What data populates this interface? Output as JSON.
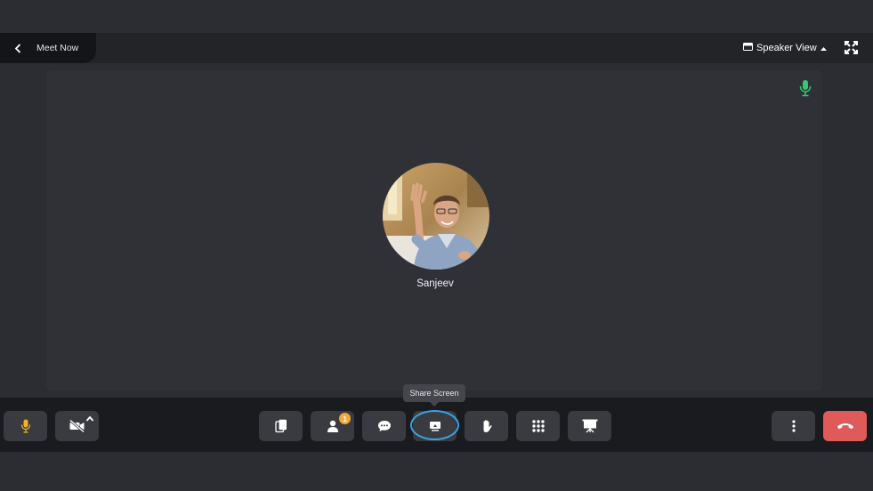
{
  "header": {
    "back_icon": "chevron-left-icon",
    "title": "Meet Now",
    "view_label": "Speaker View",
    "view_icon": "layout-icon",
    "fullscreen_icon": "fullscreen-icon"
  },
  "stage": {
    "participant_name": "Sanjeev",
    "mic_status": "active",
    "mic_color": "#2ecc71"
  },
  "toolbar": {
    "mic_icon": "microphone-icon",
    "mic_color": "#f0b429",
    "camera_icon": "video-off-icon",
    "participants_badge": "1",
    "share_tooltip": "Share Screen",
    "end_call_color": "#e05a5a",
    "buttons": [
      "microphone",
      "camera",
      "copy",
      "participants",
      "chat",
      "share-screen",
      "raise-hand",
      "apps",
      "whiteboard",
      "more",
      "end-call"
    ]
  },
  "colors": {
    "background": "#2c2d32",
    "accent": "#3aa3e8"
  }
}
